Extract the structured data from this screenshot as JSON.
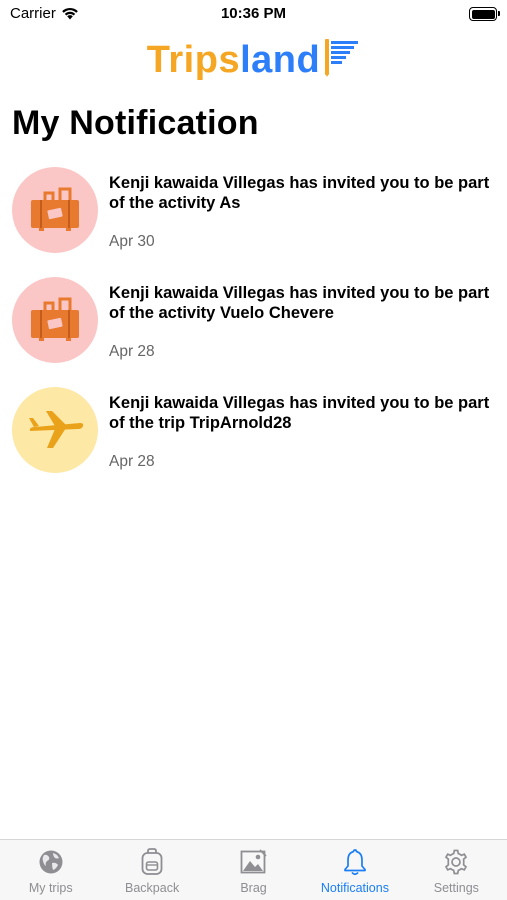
{
  "status_bar": {
    "carrier": "Carrier",
    "time": "10:36 PM"
  },
  "app": {
    "logo_part1": "Trips",
    "logo_part2": "land"
  },
  "page": {
    "title": "My Notification"
  },
  "notifications": [
    {
      "message": "Kenji kawaida Villegas has invited you to be part of the activity As",
      "date": "Apr 30",
      "icon": "suitcase-icon"
    },
    {
      "message": "Kenji kawaida Villegas has invited you to be part of the activity Vuelo Chevere",
      "date": "Apr 28",
      "icon": "suitcase-icon"
    },
    {
      "message": "Kenji kawaida Villegas has invited you to be part of the trip TripArnold28",
      "date": "Apr 28",
      "icon": "airplane-icon"
    }
  ],
  "tab_bar": {
    "tabs": [
      {
        "label": "My trips",
        "icon": "globe-icon"
      },
      {
        "label": "Backpack",
        "icon": "backpack-icon"
      },
      {
        "label": "Brag",
        "icon": "photo-icon"
      },
      {
        "label": "Notifications",
        "icon": "bell-icon",
        "active": true
      },
      {
        "label": "Settings",
        "icon": "gear-icon"
      }
    ]
  },
  "colors": {
    "brand_orange": "#f5a623",
    "brand_blue": "#2d7ff9",
    "active_tab": "#1a7ef5",
    "avatar_pink": "#fbc6c6",
    "avatar_yellow": "#fde8a6",
    "icon_orange": "#e87a2f"
  }
}
